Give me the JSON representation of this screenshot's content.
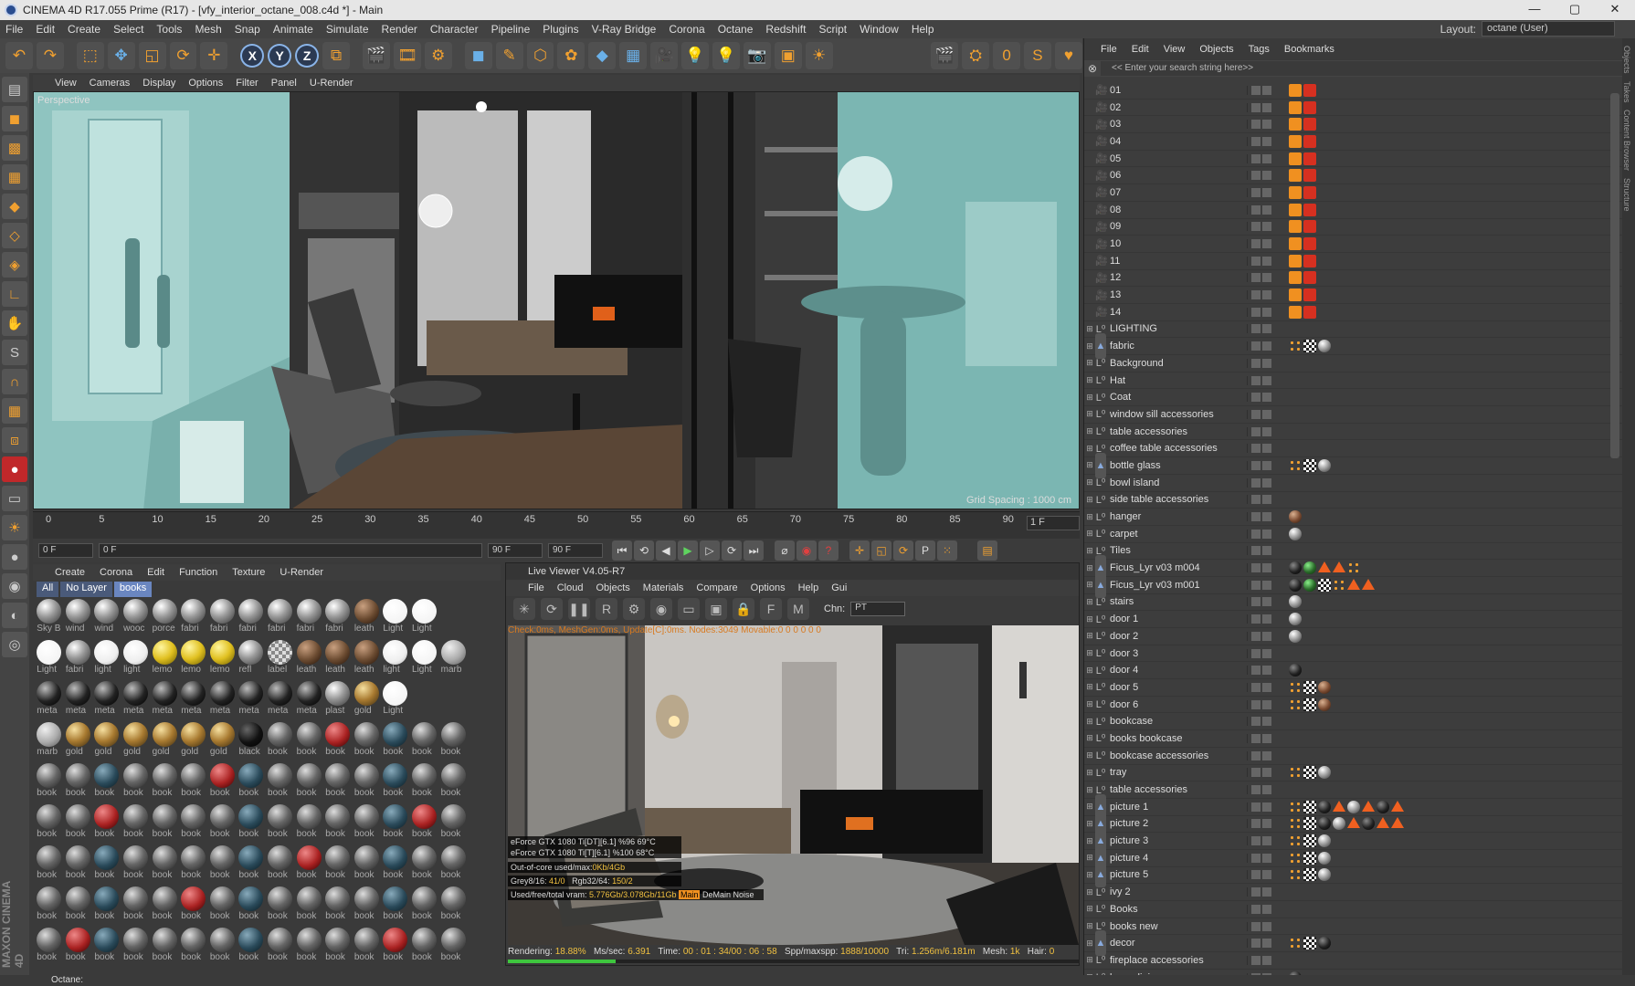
{
  "window": {
    "title": "CINEMA 4D R17.055 Prime (R17) - [vfy_interior_octane_008.c4d *] - Main",
    "min": "—",
    "max": "▢",
    "close": "✕"
  },
  "menu": [
    "File",
    "Edit",
    "Create",
    "Select",
    "Tools",
    "Mesh",
    "Snap",
    "Animate",
    "Simulate",
    "Render",
    "Character",
    "Pipeline",
    "Plugins",
    "V-Ray Bridge",
    "Corona",
    "Octane",
    "Redshift",
    "Script",
    "Window",
    "Help"
  ],
  "layout": {
    "label": "Layout:",
    "value": "octane (User)"
  },
  "viewport": {
    "menu": [
      "View",
      "Cameras",
      "Display",
      "Options",
      "Filter",
      "Panel",
      "U-Render"
    ],
    "label": "Perspective",
    "grid": "Grid Spacing : 1000 cm"
  },
  "timeline": {
    "ticks": [
      "0",
      "5",
      "10",
      "15",
      "20",
      "25",
      "30",
      "35",
      "40",
      "45",
      "50",
      "55",
      "60",
      "65",
      "70",
      "75",
      "80",
      "85",
      "90"
    ],
    "frame_end": "1 F"
  },
  "transport": {
    "start": "0 F",
    "cur": "0 F",
    "end": "90 F",
    "end2": "90 F"
  },
  "material": {
    "menu": [
      "Create",
      "Corona",
      "Edit",
      "Function",
      "Texture",
      "U-Render"
    ],
    "tabs": [
      "All",
      "No Layer",
      "books"
    ],
    "items": [
      "Sky B",
      "wind",
      "wind",
      "wooc",
      "porce",
      "fabri",
      "fabri",
      "fabri",
      "fabri",
      "fabri",
      "fabri",
      "leath",
      "Light",
      "Light",
      "",
      "Light",
      "fabri",
      "light",
      "light",
      "lemo",
      "lemo",
      "lemo",
      "refl",
      "label",
      "leath",
      "leath",
      "leath",
      "light",
      "Light",
      "marb",
      "meta",
      "meta",
      "meta",
      "meta",
      "meta",
      "meta",
      "meta",
      "meta",
      "meta",
      "meta",
      "plast",
      "gold",
      "Light",
      "",
      "",
      "marb",
      "gold",
      "gold",
      "gold",
      "gold",
      "gold",
      "gold",
      "black",
      "book",
      "book",
      "book",
      "book",
      "book",
      "book",
      "book",
      "book",
      "book",
      "book",
      "book",
      "book",
      "book",
      "book",
      "book",
      "book",
      "book",
      "book",
      "book",
      "book",
      "book",
      "book",
      "book",
      "book",
      "book",
      "book",
      "book",
      "book",
      "book",
      "book",
      "book",
      "book",
      "book",
      "book",
      "book",
      "book",
      "book",
      "book",
      "book",
      "book",
      "book",
      "book",
      "book",
      "book",
      "book",
      "book",
      "book",
      "book",
      "book",
      "book",
      "book",
      "book",
      "book",
      "book",
      "book",
      "book",
      "book",
      "book",
      "book",
      "book",
      "book",
      "book",
      "book",
      "book",
      "book",
      "book",
      "book",
      "book",
      "book",
      "book",
      "book",
      "book",
      "book",
      "book",
      "book",
      "book",
      "book",
      "book",
      "book",
      "book",
      "book",
      "book"
    ]
  },
  "liveviewer": {
    "title": "Live Viewer V4.05-R7",
    "menu": [
      "File",
      "Cloud",
      "Objects",
      "Materials",
      "Compare",
      "Options",
      "Help",
      "Gui"
    ],
    "chn_label": "Chn:",
    "chn": "PT",
    "info": "Check:0ms, MeshGen:0ms, Update[C]:0ms. Nodes:3049 Movable:0 0 0 0 0 0",
    "gpus": [
      {
        "name": "eForce GTX 1080 Ti[DT][6.1]",
        "pct": "%96",
        "temp": "69°C"
      },
      {
        "name": "eForce GTX 1080 Ti[T][6.1]",
        "pct": "%100",
        "temp": "68°C"
      }
    ],
    "ooc_label": "Out-of-core used/max:",
    "ooc": "0Kb/4Gb",
    "grey_label": "Grey8/16:",
    "grey": "41/0",
    "rgb_label": "Rgb32/64:",
    "rgb": "150/2",
    "vram_label": "Used/free/total vram:",
    "vram": "5.776Gb/3.078Gb/11Gb",
    "main": "Main",
    "demain": "DeMain",
    "noise": "Noise",
    "status": {
      "rendering_label": "Rendering:",
      "rendering": "18.88%",
      "mss_label": "Ms/sec:",
      "mss": "6.391",
      "time_label": "Time:",
      "time": "00 : 01 : 34/00 : 06 : 58",
      "spp_label": "Spp/maxspp:",
      "spp": "1888/10000",
      "tri_label": "Tri:",
      "tri": "1.256m/6.181m",
      "mesh_label": "Mesh:",
      "mesh": "1k",
      "hair_label": "Hair:",
      "hair": "0"
    },
    "progress": 0.1888
  },
  "objects": {
    "menu": [
      "File",
      "Edit",
      "View",
      "Objects",
      "Tags",
      "Bookmarks"
    ],
    "search": "<< Enter your search string here>>",
    "rows": [
      {
        "n": "01",
        "t": "cam"
      },
      {
        "n": "02",
        "t": "cam"
      },
      {
        "n": "03",
        "t": "cam"
      },
      {
        "n": "04",
        "t": "cam"
      },
      {
        "n": "05",
        "t": "cam"
      },
      {
        "n": "06",
        "t": "cam"
      },
      {
        "n": "07",
        "t": "cam"
      },
      {
        "n": "08",
        "t": "cam"
      },
      {
        "n": "09",
        "t": "cam"
      },
      {
        "n": "10",
        "t": "cam"
      },
      {
        "n": "11",
        "t": "cam"
      },
      {
        "n": "12",
        "t": "cam"
      },
      {
        "n": "13",
        "t": "cam"
      },
      {
        "n": "14",
        "t": "cam"
      },
      {
        "n": "LIGHTING",
        "t": "null"
      },
      {
        "n": "fabric",
        "t": "lt",
        "tags": [
          "dot",
          "chk",
          "sph"
        ]
      },
      {
        "n": "Background",
        "t": "null"
      },
      {
        "n": "Hat",
        "t": "null"
      },
      {
        "n": "Coat",
        "t": "null"
      },
      {
        "n": "window sill accessories",
        "t": "null"
      },
      {
        "n": "table accessories",
        "t": "null"
      },
      {
        "n": "coffee table accessories",
        "t": "null"
      },
      {
        "n": "bottle glass",
        "t": "lt",
        "tags": [
          "dot",
          "chk",
          "sph"
        ]
      },
      {
        "n": "bowl island",
        "t": "null"
      },
      {
        "n": "side table accessories",
        "t": "null"
      },
      {
        "n": "hanger",
        "t": "null",
        "tags": [
          "brn"
        ]
      },
      {
        "n": "carpet",
        "t": "null",
        "tags": [
          "sph"
        ]
      },
      {
        "n": "Tiles",
        "t": "null"
      },
      {
        "n": "Ficus_Lyr v03 m004",
        "t": "lt",
        "tags": [
          "dark",
          "grn",
          "tri",
          "tri",
          "dot"
        ]
      },
      {
        "n": "Ficus_Lyr v03 m001",
        "t": "lt",
        "tags": [
          "dark",
          "grn",
          "chk",
          "dot",
          "tri",
          "tri"
        ]
      },
      {
        "n": "stairs",
        "t": "null",
        "tags": [
          "sph"
        ]
      },
      {
        "n": "door 1",
        "t": "null",
        "tags": [
          "sph"
        ]
      },
      {
        "n": "door 2",
        "t": "null",
        "tags": [
          "sph"
        ]
      },
      {
        "n": "door 3",
        "t": "null"
      },
      {
        "n": "door 4",
        "t": "null",
        "tags": [
          "dark"
        ]
      },
      {
        "n": "door 5",
        "t": "null",
        "tags": [
          "dot",
          "chk",
          "brn"
        ]
      },
      {
        "n": "door 6",
        "t": "null",
        "tags": [
          "dot",
          "chk",
          "brn"
        ]
      },
      {
        "n": "bookcase",
        "t": "null"
      },
      {
        "n": "books  bookcase",
        "t": "null"
      },
      {
        "n": "bookcase  accessories",
        "t": "null"
      },
      {
        "n": "tray",
        "t": "null",
        "tags": [
          "dot",
          "chk",
          "sph"
        ]
      },
      {
        "n": "table accessories",
        "t": "null"
      },
      {
        "n": "picture 1",
        "t": "lt",
        "tags": [
          "dot",
          "chk",
          "dark",
          "tri",
          "sph",
          "tri",
          "dark",
          "tri"
        ]
      },
      {
        "n": "picture 2",
        "t": "lt",
        "tags": [
          "dot",
          "chk",
          "dark",
          "sph",
          "tri",
          "dark",
          "tri",
          "tri"
        ]
      },
      {
        "n": "picture 3",
        "t": "lt",
        "tags": [
          "dot",
          "chk",
          "sph"
        ]
      },
      {
        "n": "picture 4",
        "t": "lt",
        "tags": [
          "dot",
          "chk",
          "sph"
        ]
      },
      {
        "n": "picture 5",
        "t": "lt",
        "tags": [
          "dot",
          "chk",
          "sph"
        ]
      },
      {
        "n": "ivy 2",
        "t": "null"
      },
      {
        "n": "Books",
        "t": "null"
      },
      {
        "n": "books new",
        "t": "null"
      },
      {
        "n": "decor",
        "t": "lt",
        "tags": [
          "dot",
          "chk",
          "dark"
        ]
      },
      {
        "n": "fireplace accessories",
        "t": "null"
      },
      {
        "n": "lamp dining room",
        "t": "null",
        "tags": [
          "dark"
        ]
      }
    ]
  },
  "sidetabs": [
    "Objects",
    "Takes",
    "Content Browser",
    "Structure"
  ],
  "status": "Octane:",
  "maxon": "MAXON CINEMA 4D"
}
